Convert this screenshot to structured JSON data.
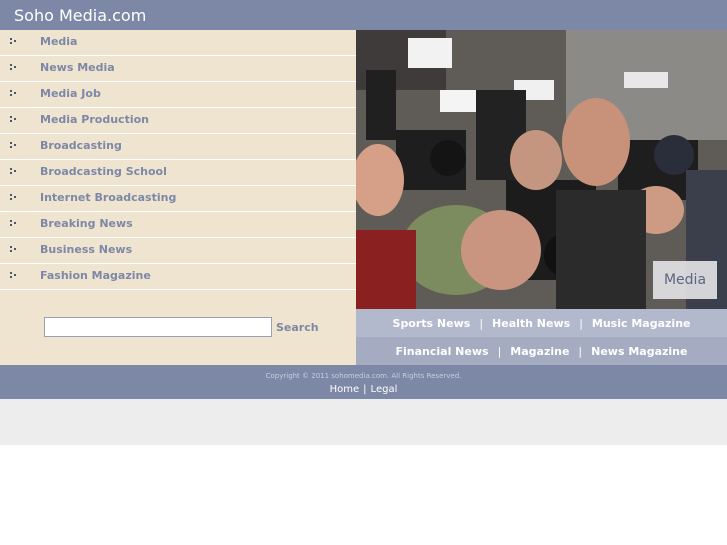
{
  "site": {
    "title": "Soho Media.com"
  },
  "sidebar": {
    "items": [
      {
        "label": "Media"
      },
      {
        "label": "News Media"
      },
      {
        "label": "Media Job"
      },
      {
        "label": "Media Production"
      },
      {
        "label": "Broadcasting"
      },
      {
        "label": "Broadcasting School"
      },
      {
        "label": "Internet Broadcasting"
      },
      {
        "label": "Breaking News"
      },
      {
        "label": "Business News"
      },
      {
        "label": "Fashion Magazine"
      }
    ],
    "item_icon": "bullet-dots-icon"
  },
  "search": {
    "value": "",
    "button_label": "Search"
  },
  "hero": {
    "caption": "Media",
    "image": "photographers-with-cameras"
  },
  "links": {
    "row1": [
      "Sports News",
      "Health News",
      "Music Magazine"
    ],
    "row2": [
      "Financial News",
      "Magazine",
      "News Magazine"
    ],
    "separator": "|"
  },
  "footer": {
    "copyright": "Copyright © 2011 sohomedia.com. All Rights Reserved.",
    "links": [
      "Home",
      "Legal"
    ],
    "separator": "|"
  },
  "colors": {
    "header": "#7d88a6",
    "sidebar": "#efe4d0",
    "link_bar_top": "#b3b9cc",
    "link_bar_bottom": "#a5acc2",
    "bottom_band": "#ededed"
  }
}
